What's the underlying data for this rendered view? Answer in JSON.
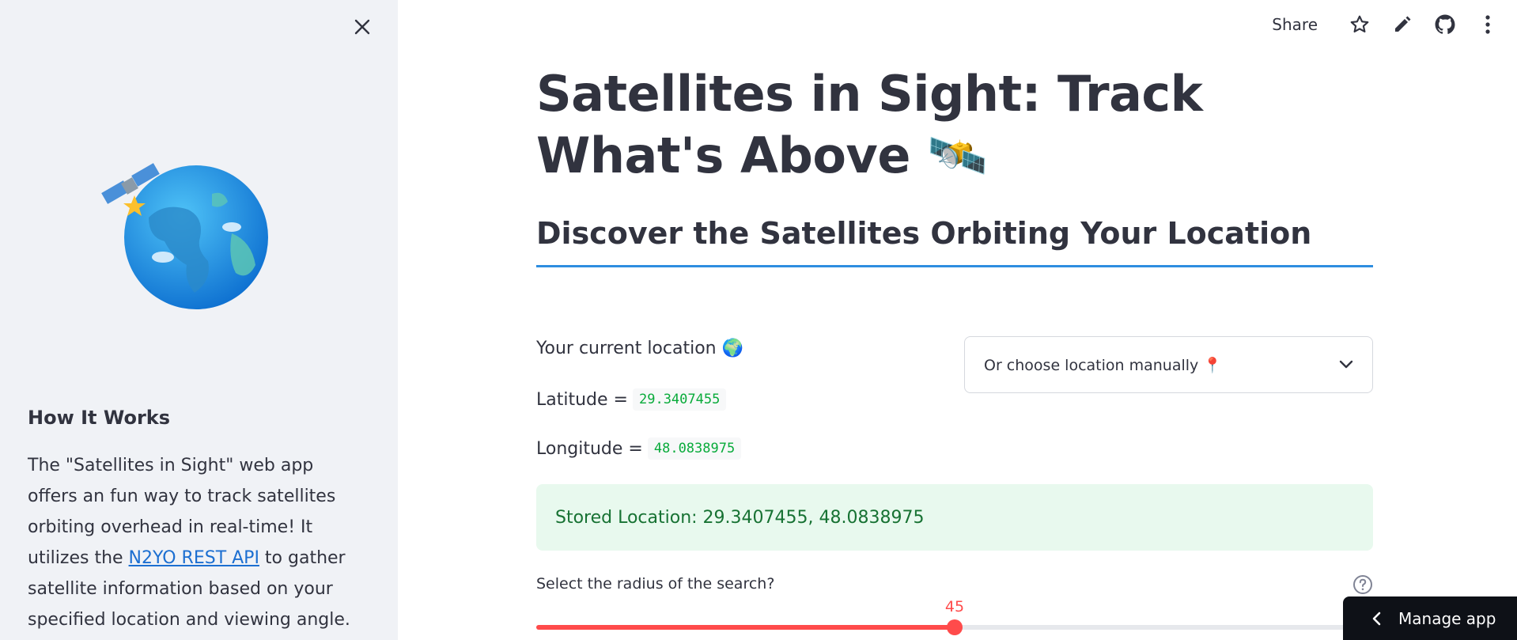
{
  "sidebar": {
    "heading": "How It Works",
    "desc_before_link": "The \"Satellites in Sight\" web app offers an fun way to track satellites orbiting overhead in real-time! It utilizes the ",
    "link_text": "N2YO REST API",
    "desc_after_link": " to gather satellite information based on your specified location and viewing angle. You can also filter by"
  },
  "toolbar": {
    "share_label": "Share"
  },
  "main": {
    "title": "Satellites in Sight: Track What's Above 🛰️",
    "subtitle": "Discover the Satellites Orbiting Your Location",
    "location_label": "Your current location 🌍",
    "latitude_label": "Latitude =",
    "latitude_value": "29.3407455",
    "longitude_label": "Longitude =",
    "longitude_value": "48.0838975",
    "select_text": "Or choose location manually 📍",
    "stored_location": "Stored Location: 29.3407455, 48.0838975",
    "slider_label": "Select the radius of the search?",
    "slider_value": "45",
    "slider_min": 0,
    "slider_max": 90
  },
  "manage_app_label": "Manage app",
  "colors": {
    "accent": "#ff4b4b",
    "link": "#1c6fd1",
    "success_bg": "#e8f9ee",
    "success_text": "#177233",
    "code_text": "#09ab3b",
    "underline": "#2e8de0"
  }
}
